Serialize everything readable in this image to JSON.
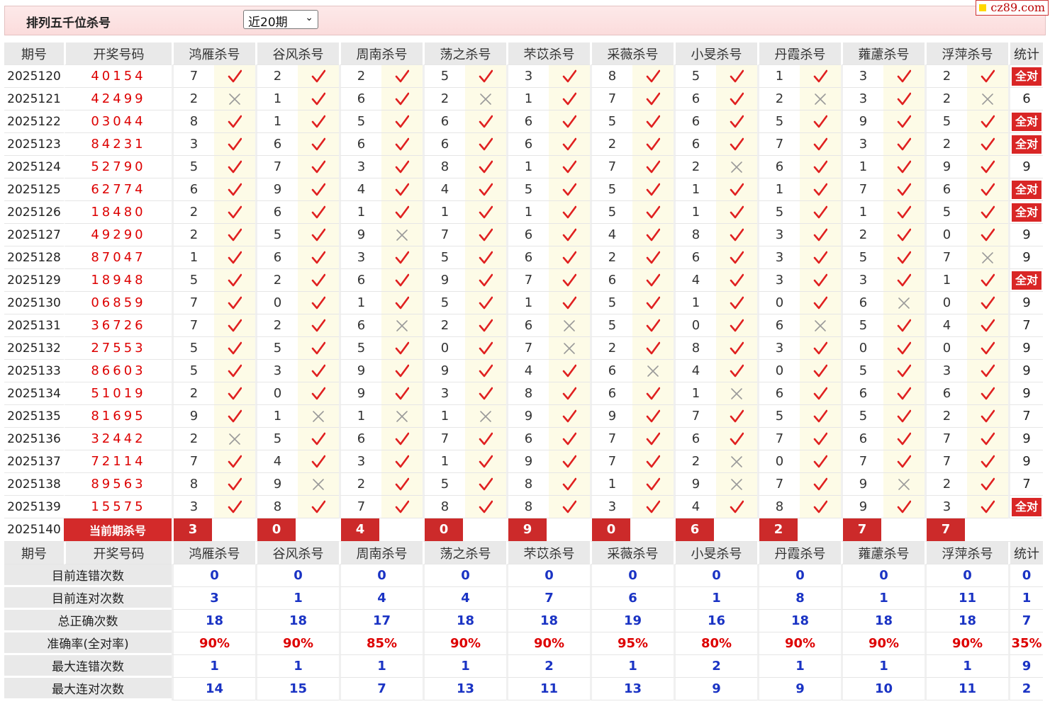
{
  "header": {
    "title": "排列五千位杀号",
    "range_selected": "近20期",
    "logo_text": "cz89.com"
  },
  "columns": {
    "period": "期号",
    "draw": "开奖号码",
    "experts": [
      "鸿雁杀号",
      "谷风杀号",
      "周南杀号",
      "荡之杀号",
      "芣苡杀号",
      "采薇杀号",
      "小旻杀号",
      "丹霞杀号",
      "蕹藘杀号",
      "浮萍杀号"
    ],
    "stat": "统计"
  },
  "rows": [
    {
      "period": "2025120",
      "draw": "40154",
      "kills": [
        7,
        2,
        2,
        5,
        3,
        8,
        5,
        1,
        3,
        2
      ],
      "ok": [
        1,
        1,
        1,
        1,
        1,
        1,
        1,
        1,
        1,
        1
      ],
      "stat": "全对"
    },
    {
      "period": "2025121",
      "draw": "42499",
      "kills": [
        2,
        1,
        6,
        2,
        1,
        7,
        6,
        2,
        3,
        2
      ],
      "ok": [
        0,
        1,
        1,
        0,
        1,
        1,
        1,
        0,
        1,
        0
      ],
      "stat": "6"
    },
    {
      "period": "2025122",
      "draw": "03044",
      "kills": [
        8,
        1,
        5,
        6,
        6,
        5,
        6,
        5,
        9,
        5
      ],
      "ok": [
        1,
        1,
        1,
        1,
        1,
        1,
        1,
        1,
        1,
        1
      ],
      "stat": "全对"
    },
    {
      "period": "2025123",
      "draw": "84231",
      "kills": [
        3,
        6,
        6,
        6,
        6,
        2,
        6,
        7,
        3,
        2
      ],
      "ok": [
        1,
        1,
        1,
        1,
        1,
        1,
        1,
        1,
        1,
        1
      ],
      "stat": "全对"
    },
    {
      "period": "2025124",
      "draw": "52790",
      "kills": [
        5,
        7,
        3,
        8,
        1,
        7,
        2,
        6,
        1,
        9
      ],
      "ok": [
        1,
        1,
        1,
        1,
        1,
        1,
        0,
        1,
        1,
        1
      ],
      "stat": "9"
    },
    {
      "period": "2025125",
      "draw": "62774",
      "kills": [
        6,
        9,
        4,
        4,
        5,
        5,
        1,
        1,
        7,
        6
      ],
      "ok": [
        1,
        1,
        1,
        1,
        1,
        1,
        1,
        1,
        1,
        1
      ],
      "stat": "全对"
    },
    {
      "period": "2025126",
      "draw": "18480",
      "kills": [
        2,
        6,
        1,
        1,
        1,
        5,
        1,
        5,
        1,
        5
      ],
      "ok": [
        1,
        1,
        1,
        1,
        1,
        1,
        1,
        1,
        1,
        1
      ],
      "stat": "全对"
    },
    {
      "period": "2025127",
      "draw": "49290",
      "kills": [
        2,
        5,
        9,
        7,
        6,
        4,
        8,
        3,
        2,
        0
      ],
      "ok": [
        1,
        1,
        0,
        1,
        1,
        1,
        1,
        1,
        1,
        1
      ],
      "stat": "9"
    },
    {
      "period": "2025128",
      "draw": "87047",
      "kills": [
        1,
        6,
        3,
        5,
        6,
        2,
        6,
        3,
        5,
        7
      ],
      "ok": [
        1,
        1,
        1,
        1,
        1,
        1,
        1,
        1,
        1,
        0
      ],
      "stat": "9"
    },
    {
      "period": "2025129",
      "draw": "18948",
      "kills": [
        5,
        2,
        6,
        9,
        7,
        6,
        4,
        3,
        3,
        1
      ],
      "ok": [
        1,
        1,
        1,
        1,
        1,
        1,
        1,
        1,
        1,
        1
      ],
      "stat": "全对"
    },
    {
      "period": "2025130",
      "draw": "06859",
      "kills": [
        7,
        0,
        1,
        5,
        1,
        5,
        1,
        0,
        6,
        0
      ],
      "ok": [
        1,
        1,
        1,
        1,
        1,
        1,
        1,
        1,
        0,
        1
      ],
      "stat": "9"
    },
    {
      "period": "2025131",
      "draw": "36726",
      "kills": [
        7,
        2,
        6,
        2,
        6,
        5,
        0,
        6,
        5,
        4
      ],
      "ok": [
        1,
        1,
        0,
        1,
        0,
        1,
        1,
        0,
        1,
        1
      ],
      "stat": "7"
    },
    {
      "period": "2025132",
      "draw": "27553",
      "kills": [
        5,
        5,
        5,
        0,
        7,
        2,
        8,
        3,
        0,
        0
      ],
      "ok": [
        1,
        1,
        1,
        1,
        0,
        1,
        1,
        1,
        1,
        1
      ],
      "stat": "9"
    },
    {
      "period": "2025133",
      "draw": "86603",
      "kills": [
        5,
        3,
        9,
        9,
        4,
        6,
        4,
        0,
        5,
        3
      ],
      "ok": [
        1,
        1,
        1,
        1,
        1,
        0,
        1,
        1,
        1,
        1
      ],
      "stat": "9"
    },
    {
      "period": "2025134",
      "draw": "51019",
      "kills": [
        2,
        0,
        9,
        3,
        8,
        6,
        1,
        6,
        6,
        6
      ],
      "ok": [
        1,
        1,
        1,
        1,
        1,
        1,
        0,
        1,
        1,
        1
      ],
      "stat": "9"
    },
    {
      "period": "2025135",
      "draw": "81695",
      "kills": [
        9,
        1,
        1,
        1,
        9,
        9,
        7,
        5,
        5,
        2
      ],
      "ok": [
        1,
        0,
        0,
        0,
        1,
        1,
        1,
        1,
        1,
        1
      ],
      "stat": "7"
    },
    {
      "period": "2025136",
      "draw": "32442",
      "kills": [
        2,
        5,
        6,
        7,
        6,
        7,
        6,
        7,
        6,
        7
      ],
      "ok": [
        0,
        1,
        1,
        1,
        1,
        1,
        1,
        1,
        1,
        1
      ],
      "stat": "9"
    },
    {
      "period": "2025137",
      "draw": "72114",
      "kills": [
        7,
        4,
        3,
        1,
        9,
        7,
        2,
        0,
        7,
        7
      ],
      "ok": [
        1,
        1,
        1,
        1,
        1,
        1,
        0,
        1,
        1,
        1
      ],
      "stat": "9"
    },
    {
      "period": "2025138",
      "draw": "89563",
      "kills": [
        8,
        9,
        2,
        5,
        8,
        1,
        9,
        7,
        9,
        2
      ],
      "ok": [
        1,
        0,
        1,
        1,
        1,
        1,
        0,
        1,
        0,
        1
      ],
      "stat": "7"
    },
    {
      "period": "2025139",
      "draw": "15575",
      "kills": [
        3,
        8,
        7,
        8,
        8,
        3,
        4,
        8,
        9,
        3
      ],
      "ok": [
        1,
        1,
        1,
        1,
        1,
        1,
        1,
        1,
        1,
        1
      ],
      "stat": "全对"
    }
  ],
  "current": {
    "period": "2025140",
    "label": "当前期杀号",
    "kills": [
      3,
      0,
      4,
      0,
      9,
      0,
      6,
      2,
      7,
      7
    ]
  },
  "summary": [
    {
      "label": "目前连错次数",
      "values": [
        "0",
        "0",
        "0",
        "0",
        "0",
        "0",
        "0",
        "0",
        "0",
        "0"
      ],
      "stat": "0",
      "pct": false
    },
    {
      "label": "目前连对次数",
      "values": [
        "3",
        "1",
        "4",
        "4",
        "7",
        "6",
        "1",
        "8",
        "1",
        "11"
      ],
      "stat": "1",
      "pct": false
    },
    {
      "label": "总正确次数",
      "values": [
        "18",
        "18",
        "17",
        "18",
        "18",
        "19",
        "16",
        "18",
        "18",
        "18"
      ],
      "stat": "7",
      "pct": false
    },
    {
      "label": "准确率(全对率)",
      "values": [
        "90%",
        "90%",
        "85%",
        "90%",
        "90%",
        "95%",
        "80%",
        "90%",
        "90%",
        "90%"
      ],
      "stat": "35%",
      "pct": true
    },
    {
      "label": "最大连错次数",
      "values": [
        "1",
        "1",
        "1",
        "1",
        "2",
        "1",
        "2",
        "1",
        "1",
        "1"
      ],
      "stat": "9",
      "pct": false
    },
    {
      "label": "最大连对次数",
      "values": [
        "14",
        "15",
        "7",
        "13",
        "11",
        "13",
        "9",
        "9",
        "10",
        "11"
      ],
      "stat": "2",
      "pct": false
    }
  ],
  "colors": {
    "accent_red": "#d92626",
    "value_blue": "#1a33c4",
    "mark_bg": "#fdfbe7"
  }
}
